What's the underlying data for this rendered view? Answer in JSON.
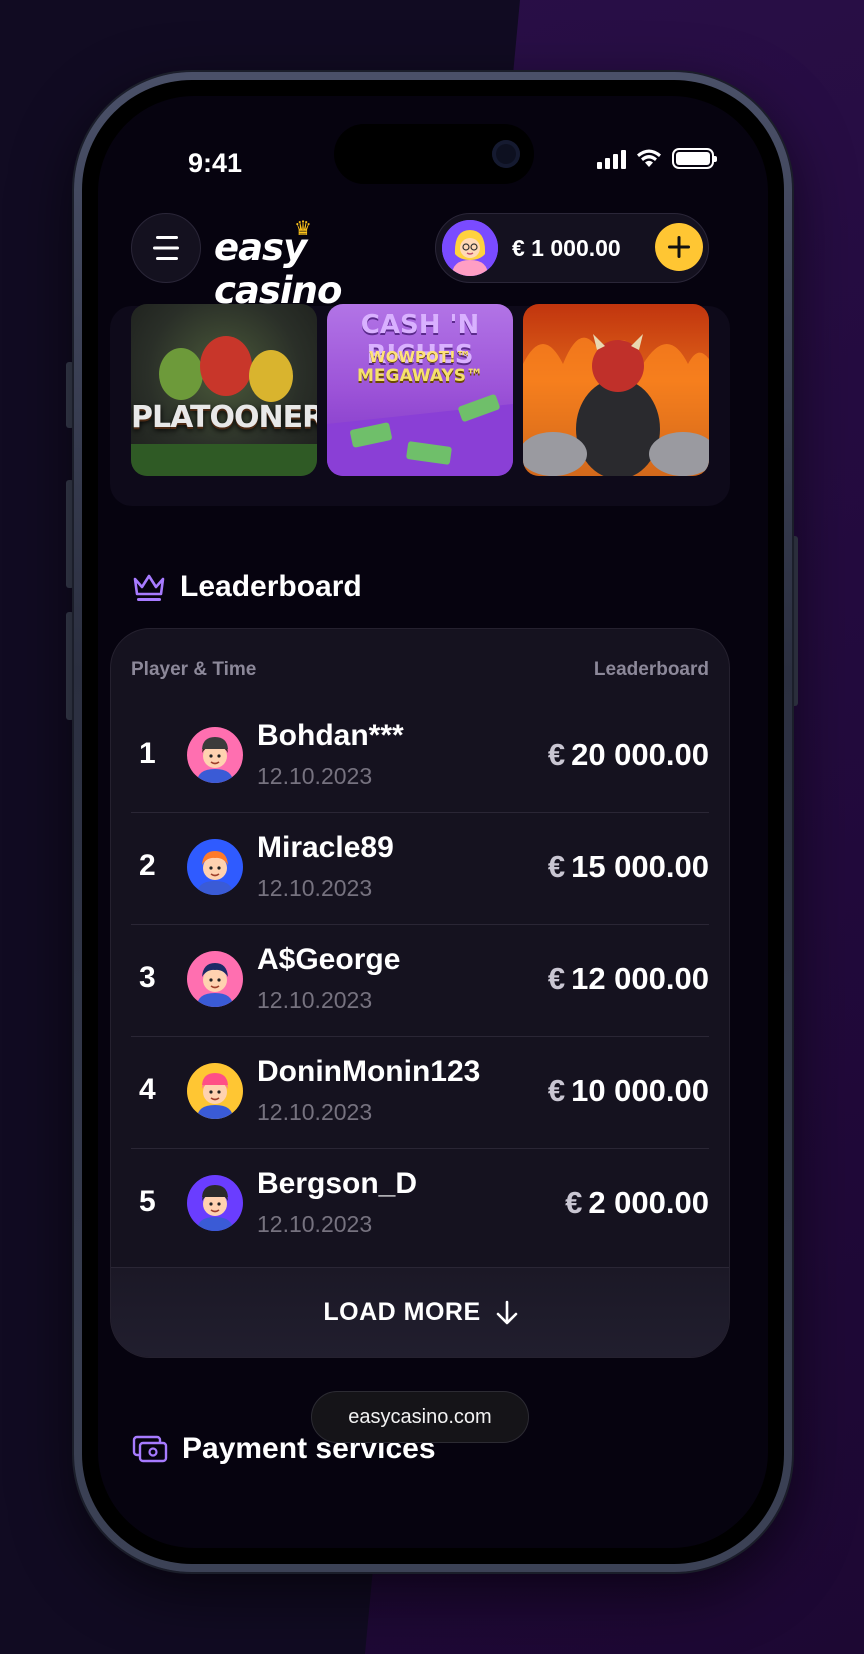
{
  "status_bar": {
    "time": "9:41"
  },
  "header": {
    "logo_text": "easy casino",
    "balance": "€ 1 000.00",
    "plus_symbol": "+"
  },
  "games": [
    {
      "title": "PLATOONERS"
    },
    {
      "title_line1": "CASH 'N RICHES",
      "title_line2": "WOWPOT!™",
      "title_line3": "MEGAWAYS™"
    },
    {
      "title": ""
    }
  ],
  "leaderboard": {
    "section_title": "Leaderboard",
    "col_left": "Player & Time",
    "col_right": "Leaderboard",
    "currency": "€",
    "rows": [
      {
        "rank": "1",
        "name": "Bohdan***",
        "date": "12.10.2023",
        "amount": "20 000.00",
        "avatar_color": "#ff6fb0"
      },
      {
        "rank": "2",
        "name": "Miracle89",
        "date": "12.10.2023",
        "amount": "15 000.00",
        "avatar_color": "#2f5bff"
      },
      {
        "rank": "3",
        "name": "A$George",
        "date": "12.10.2023",
        "amount": "12 000.00",
        "avatar_color": "#ff6fb0"
      },
      {
        "rank": "4",
        "name": "DoninMonin123",
        "date": "12.10.2023",
        "amount": "10 000.00",
        "avatar_color": "#ffc633"
      },
      {
        "rank": "5",
        "name": "Bergson_D",
        "date": "12.10.2023",
        "amount": "2 000.00",
        "avatar_color": "#6a3dff"
      }
    ],
    "load_more": "LOAD MORE"
  },
  "payment": {
    "section_title": "Payment services"
  },
  "browser": {
    "url": "easycasino.com"
  },
  "colors": {
    "accent_yellow": "#ffc633",
    "accent_purple": "#a77bff",
    "bg": "#06030f"
  }
}
